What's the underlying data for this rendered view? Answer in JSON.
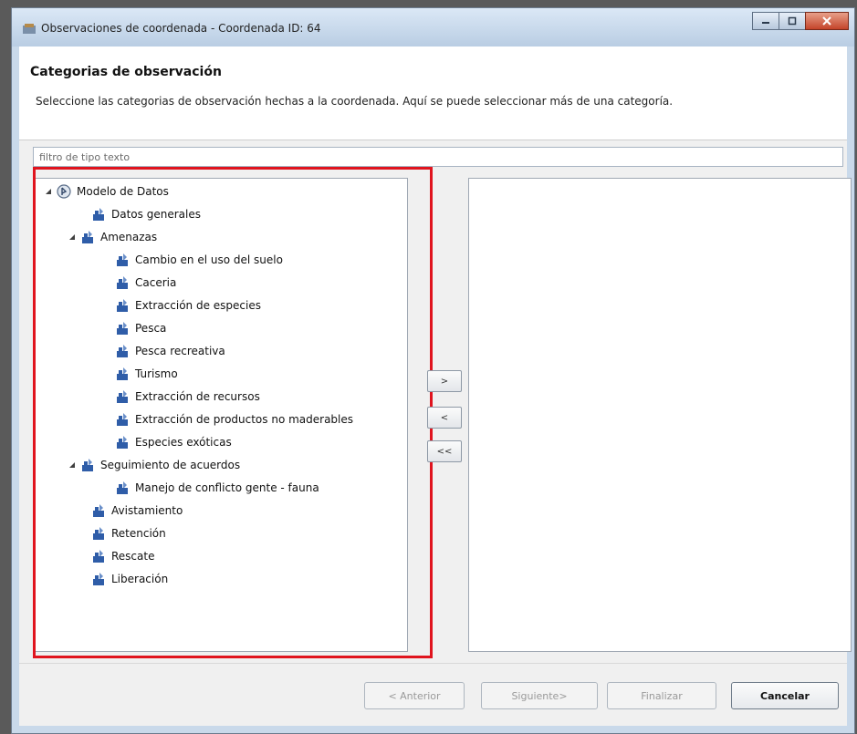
{
  "window": {
    "title": "Observaciones de coordenada - Coordenada ID: 64",
    "controls": [
      "minimize-icon",
      "maximize-icon",
      "close-icon"
    ]
  },
  "header": {
    "title": "Categorias de observación",
    "description": "Seleccione las categorias de observación hechas a la coordenada. Aquí se puede seleccionar más de una categoría."
  },
  "filter": {
    "placeholder": "filtro de tipo texto",
    "value": ""
  },
  "tree": {
    "items": [
      {
        "label": "Modelo de Datos",
        "icon": "datamodel-icon"
      },
      {
        "label": "Datos generales",
        "icon": "category-icon"
      },
      {
        "label": "Amenazas",
        "icon": "category-icon"
      },
      {
        "label": "Cambio en el uso del suelo",
        "icon": "category-icon"
      },
      {
        "label": "Caceria",
        "icon": "category-icon"
      },
      {
        "label": "Extracción de especies",
        "icon": "category-icon"
      },
      {
        "label": "Pesca",
        "icon": "category-icon"
      },
      {
        "label": "Pesca recreativa",
        "icon": "category-icon"
      },
      {
        "label": "Turismo",
        "icon": "category-icon"
      },
      {
        "label": "Extracción de recursos",
        "icon": "category-icon"
      },
      {
        "label": "Extracción de productos no maderables",
        "icon": "category-icon"
      },
      {
        "label": "Especies exóticas",
        "icon": "category-icon"
      },
      {
        "label": "Seguimiento de acuerdos",
        "icon": "category-icon"
      },
      {
        "label": "Manejo de conflicto gente - fauna",
        "icon": "category-icon"
      },
      {
        "label": "Avistamiento",
        "icon": "category-icon"
      },
      {
        "label": "Retención",
        "icon": "category-icon"
      },
      {
        "label": "Rescate",
        "icon": "category-icon"
      },
      {
        "label": "Liberación",
        "icon": "category-icon"
      }
    ]
  },
  "move_buttons": {
    "add": ">",
    "remove": "<",
    "remove_all": "<<"
  },
  "footer": {
    "back": "< Anterior",
    "next": "Siguiente>",
    "finish": "Finalizar",
    "cancel": "Cancelar"
  },
  "colors": {
    "highlight": "#e0141e",
    "node_icon": "#2f5da8"
  }
}
